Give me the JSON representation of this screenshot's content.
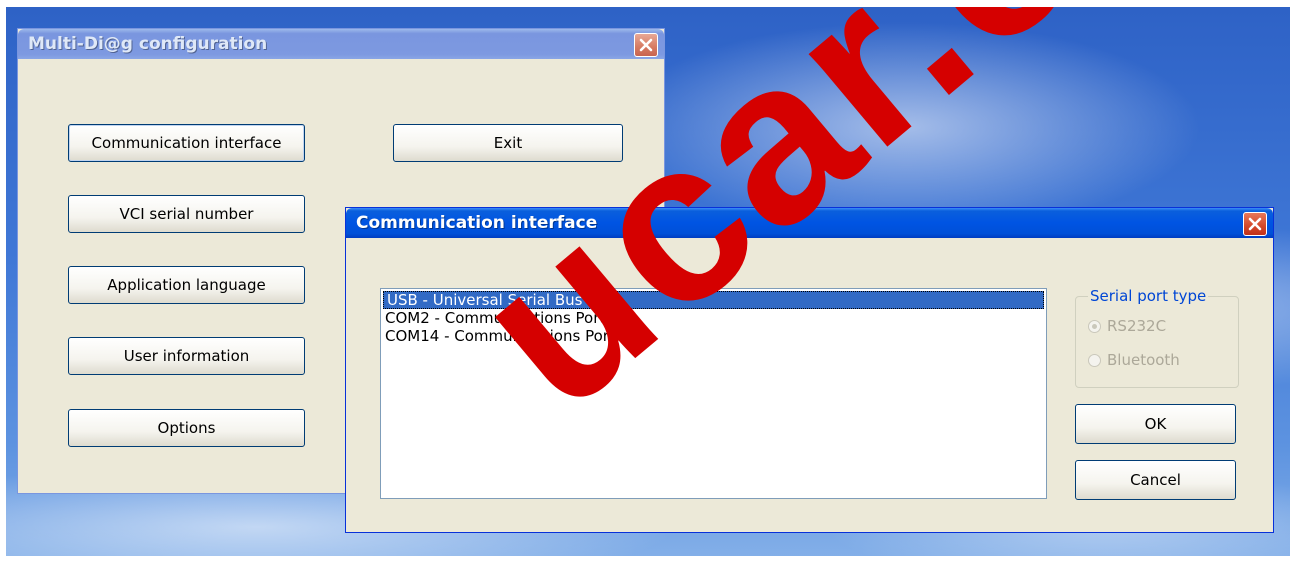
{
  "main_window": {
    "title": "Multi-Di@g configuration",
    "buttons": {
      "communication_interface": "Communication interface",
      "vci_serial_number": "VCI serial number",
      "application_language": "Application language",
      "user_information": "User information",
      "options": "Options",
      "exit": "Exit"
    }
  },
  "dialog": {
    "title": "Communication interface",
    "list_items": [
      "USB - Universal Serial Bus",
      "COM2 - Communications Port",
      "COM14 - Communications Port"
    ],
    "selected_index": 0,
    "serial_port_group": {
      "title": "Serial port type",
      "options": [
        "RS232C",
        "Bluetooth"
      ],
      "selected": "RS232C",
      "enabled": false
    },
    "ok_label": "OK",
    "cancel_label": "Cancel"
  },
  "colors": {
    "window_face": "#ece9d8",
    "active_title": "#0054e3",
    "inactive_title": "#7a96df",
    "selection": "#316ac5",
    "watermark": "#d50000",
    "close_button": "#d4482a"
  },
  "watermark_text": "ucar.com"
}
